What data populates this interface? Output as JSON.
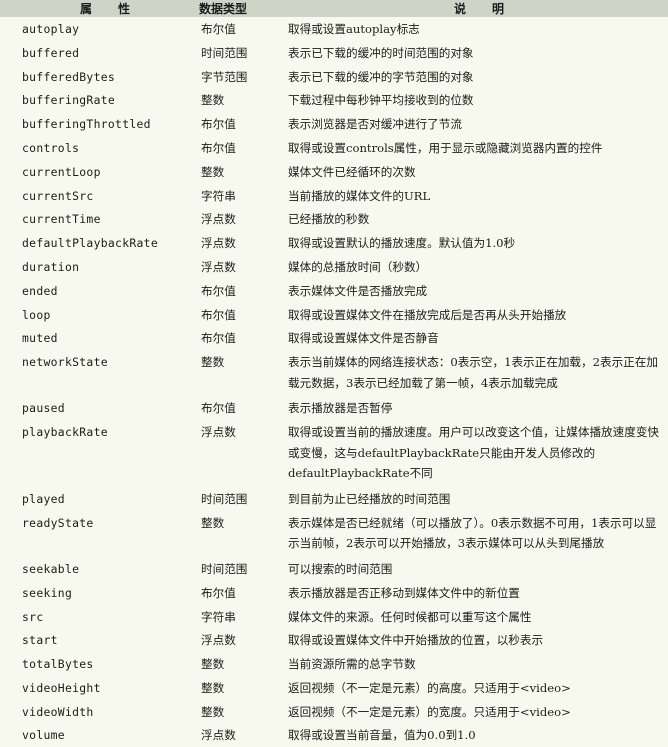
{
  "header": {
    "name": "属性",
    "type": "数据类型",
    "desc": "说明"
  },
  "rows": [
    {
      "name": "autoplay",
      "type": "布尔值",
      "desc": "取得或设置autoplay标志"
    },
    {
      "name": "buffered",
      "type": "时间范围",
      "desc": "表示已下载的缓冲的时间范围的对象"
    },
    {
      "name": "bufferedBytes",
      "type": "字节范围",
      "desc": "表示已下载的缓冲的字节范围的对象"
    },
    {
      "name": "bufferingRate",
      "type": "整数",
      "desc": "下载过程中每秒钟平均接收到的位数"
    },
    {
      "name": "bufferingThrottled",
      "type": "布尔值",
      "desc": "表示浏览器是否对缓冲进行了节流"
    },
    {
      "name": "controls",
      "type": "布尔值",
      "desc": "取得或设置controls属性，用于显示或隐藏浏览器内置的控件"
    },
    {
      "name": "currentLoop",
      "type": "整数",
      "desc": "媒体文件已经循环的次数"
    },
    {
      "name": "currentSrc",
      "type": "字符串",
      "desc": "当前播放的媒体文件的URL"
    },
    {
      "name": "currentTime",
      "type": "浮点数",
      "desc": "已经播放的秒数"
    },
    {
      "name": "defaultPlaybackRate",
      "type": "浮点数",
      "desc": "取得或设置默认的播放速度。默认值为1.0秒"
    },
    {
      "name": "duration",
      "type": "浮点数",
      "desc": "媒体的总播放时间（秒数）"
    },
    {
      "name": "ended",
      "type": "布尔值",
      "desc": "表示媒体文件是否播放完成"
    },
    {
      "name": "loop",
      "type": "布尔值",
      "desc": "取得或设置媒体文件在播放完成后是否再从头开始播放"
    },
    {
      "name": "muted",
      "type": "布尔值",
      "desc": "取得或设置媒体文件是否静音"
    },
    {
      "name": "networkState",
      "type": "整数",
      "desc": "表示当前媒体的网络连接状态：0表示空，1表示正在加载，2表示正在加载元数据，3表示已经加载了第一帧，4表示加载完成"
    },
    {
      "name": "paused",
      "type": "布尔值",
      "desc": "表示播放器是否暂停"
    },
    {
      "name": "playbackRate",
      "type": "浮点数",
      "desc": "取得或设置当前的播放速度。用户可以改变这个值，让媒体播放速度变快或变慢，这与defaultPlaybackRate只能由开发人员修改的defaultPlaybackRate不同"
    },
    {
      "name": "played",
      "type": "时间范围",
      "desc": "到目前为止已经播放的时间范围"
    },
    {
      "name": "readyState",
      "type": "整数",
      "desc": "表示媒体是否已经就绪（可以播放了）。0表示数据不可用，1表示可以显示当前帧，2表示可以开始播放，3表示媒体可以从头到尾播放"
    },
    {
      "name": "seekable",
      "type": "时间范围",
      "desc": "可以搜索的时间范围"
    },
    {
      "name": "seeking",
      "type": "布尔值",
      "desc": "表示播放器是否正移动到媒体文件中的新位置"
    },
    {
      "name": "src",
      "type": "字符串",
      "desc": "媒体文件的来源。任何时候都可以重写这个属性"
    },
    {
      "name": "start",
      "type": "浮点数",
      "desc": "取得或设置媒体文件中开始播放的位置，以秒表示"
    },
    {
      "name": "totalBytes",
      "type": "整数",
      "desc": "当前资源所需的总字节数"
    },
    {
      "name": "videoHeight",
      "type": "整数",
      "desc": "返回视频（不一定是元素）的高度。只适用于<video>"
    },
    {
      "name": "videoWidth",
      "type": "整数",
      "desc": "返回视频（不一定是元素）的宽度。只适用于<video>"
    },
    {
      "name": "volume",
      "type": "浮点数",
      "desc": "取得或设置当前音量，值为0.0到1.0"
    }
  ]
}
